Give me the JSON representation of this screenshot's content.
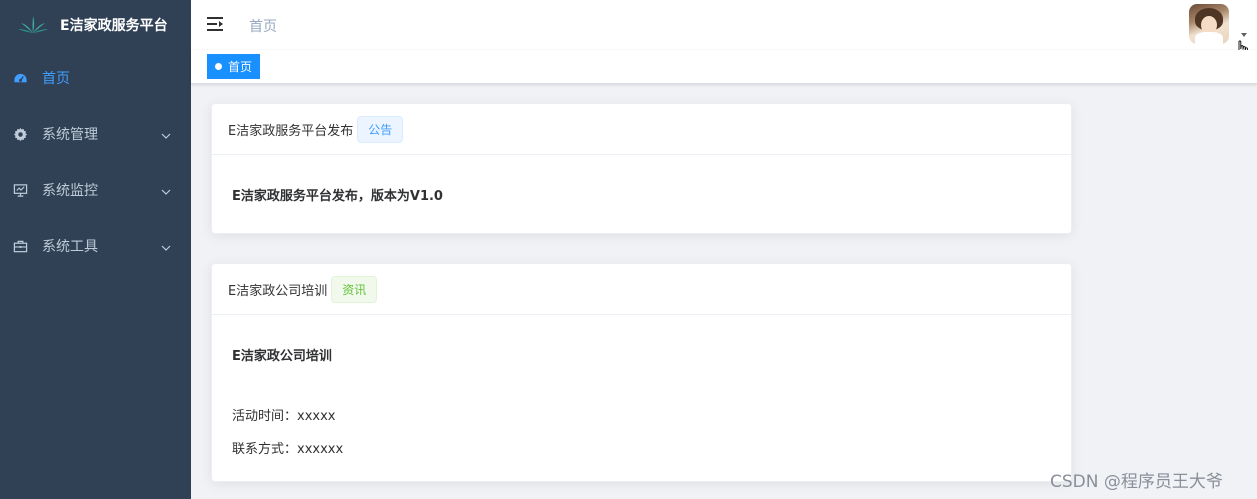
{
  "app": {
    "title": "E洁家政服务平台"
  },
  "sidebar": {
    "items": [
      {
        "label": "首页",
        "icon": "dashboard-icon",
        "active": true
      },
      {
        "label": "系统管理",
        "icon": "gear-icon",
        "expandable": true
      },
      {
        "label": "系统监控",
        "icon": "monitor-icon",
        "expandable": true
      },
      {
        "label": "系统工具",
        "icon": "toolbox-icon",
        "expandable": true
      }
    ],
    "active_color": "#409eff",
    "background": "#304156"
  },
  "navbar": {
    "breadcrumb": "首页"
  },
  "tags": {
    "items": [
      {
        "label": "首页",
        "active": true
      }
    ],
    "active_color": "#1890ff"
  },
  "notices": [
    {
      "title": "E洁家政服务平台发布",
      "tag": "公告",
      "headline": "E洁家政服务平台发布，版本为V1.0"
    },
    {
      "title": "E洁家政公司培训",
      "tag": "资讯",
      "headline": "E洁家政公司培训",
      "lines": [
        "活动时间：xxxxx",
        "联系方式：xxxxxx"
      ]
    }
  ],
  "watermark": "CSDN @程序员王大爷"
}
